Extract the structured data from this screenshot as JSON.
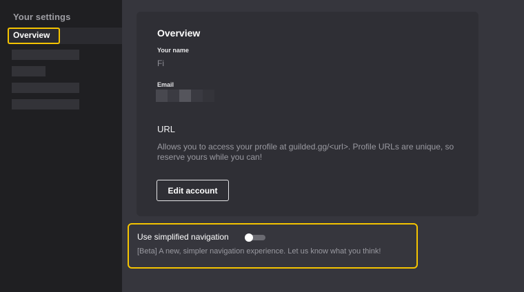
{
  "sidebar": {
    "heading": "Your settings",
    "active_item": "Overview"
  },
  "overview": {
    "title": "Overview",
    "name_label": "Your name",
    "name_value": "Fi",
    "email_label": "Email",
    "url_heading": "URL",
    "url_description": "Allows you to access your profile at guilded.gg/<url>. Profile URLs are unique, so reserve yours while you can!",
    "edit_button": "Edit account"
  },
  "simplified_navigation": {
    "label": "Use simplified navigation",
    "enabled": false,
    "description": "[Beta] A new, simpler navigation experience. Let us know what you think!"
  },
  "colors": {
    "highlight": "#f5c400",
    "sidebar_bg": "#1f1f22",
    "main_bg": "#36363d",
    "card_bg": "#2f2f35"
  }
}
